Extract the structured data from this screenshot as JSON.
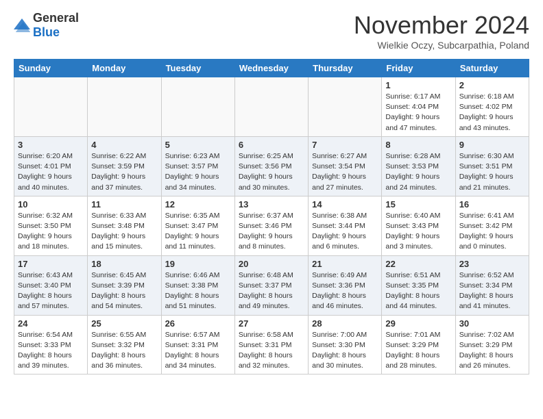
{
  "header": {
    "logo_general": "General",
    "logo_blue": "Blue",
    "month_title": "November 2024",
    "subtitle": "Wielkie Oczy, Subcarpathia, Poland"
  },
  "days_of_week": [
    "Sunday",
    "Monday",
    "Tuesday",
    "Wednesday",
    "Thursday",
    "Friday",
    "Saturday"
  ],
  "weeks": [
    {
      "row_class": "row-even",
      "days": [
        {
          "num": "",
          "info": "",
          "empty": true
        },
        {
          "num": "",
          "info": "",
          "empty": true
        },
        {
          "num": "",
          "info": "",
          "empty": true
        },
        {
          "num": "",
          "info": "",
          "empty": true
        },
        {
          "num": "",
          "info": "",
          "empty": true
        },
        {
          "num": "1",
          "info": "Sunrise: 6:17 AM\nSunset: 4:04 PM\nDaylight: 9 hours\nand 47 minutes.",
          "empty": false
        },
        {
          "num": "2",
          "info": "Sunrise: 6:18 AM\nSunset: 4:02 PM\nDaylight: 9 hours\nand 43 minutes.",
          "empty": false
        }
      ]
    },
    {
      "row_class": "row-odd",
      "days": [
        {
          "num": "3",
          "info": "Sunrise: 6:20 AM\nSunset: 4:01 PM\nDaylight: 9 hours\nand 40 minutes.",
          "empty": false
        },
        {
          "num": "4",
          "info": "Sunrise: 6:22 AM\nSunset: 3:59 PM\nDaylight: 9 hours\nand 37 minutes.",
          "empty": false
        },
        {
          "num": "5",
          "info": "Sunrise: 6:23 AM\nSunset: 3:57 PM\nDaylight: 9 hours\nand 34 minutes.",
          "empty": false
        },
        {
          "num": "6",
          "info": "Sunrise: 6:25 AM\nSunset: 3:56 PM\nDaylight: 9 hours\nand 30 minutes.",
          "empty": false
        },
        {
          "num": "7",
          "info": "Sunrise: 6:27 AM\nSunset: 3:54 PM\nDaylight: 9 hours\nand 27 minutes.",
          "empty": false
        },
        {
          "num": "8",
          "info": "Sunrise: 6:28 AM\nSunset: 3:53 PM\nDaylight: 9 hours\nand 24 minutes.",
          "empty": false
        },
        {
          "num": "9",
          "info": "Sunrise: 6:30 AM\nSunset: 3:51 PM\nDaylight: 9 hours\nand 21 minutes.",
          "empty": false
        }
      ]
    },
    {
      "row_class": "row-even",
      "days": [
        {
          "num": "10",
          "info": "Sunrise: 6:32 AM\nSunset: 3:50 PM\nDaylight: 9 hours\nand 18 minutes.",
          "empty": false
        },
        {
          "num": "11",
          "info": "Sunrise: 6:33 AM\nSunset: 3:48 PM\nDaylight: 9 hours\nand 15 minutes.",
          "empty": false
        },
        {
          "num": "12",
          "info": "Sunrise: 6:35 AM\nSunset: 3:47 PM\nDaylight: 9 hours\nand 11 minutes.",
          "empty": false
        },
        {
          "num": "13",
          "info": "Sunrise: 6:37 AM\nSunset: 3:46 PM\nDaylight: 9 hours\nand 8 minutes.",
          "empty": false
        },
        {
          "num": "14",
          "info": "Sunrise: 6:38 AM\nSunset: 3:44 PM\nDaylight: 9 hours\nand 6 minutes.",
          "empty": false
        },
        {
          "num": "15",
          "info": "Sunrise: 6:40 AM\nSunset: 3:43 PM\nDaylight: 9 hours\nand 3 minutes.",
          "empty": false
        },
        {
          "num": "16",
          "info": "Sunrise: 6:41 AM\nSunset: 3:42 PM\nDaylight: 9 hours\nand 0 minutes.",
          "empty": false
        }
      ]
    },
    {
      "row_class": "row-odd",
      "days": [
        {
          "num": "17",
          "info": "Sunrise: 6:43 AM\nSunset: 3:40 PM\nDaylight: 8 hours\nand 57 minutes.",
          "empty": false
        },
        {
          "num": "18",
          "info": "Sunrise: 6:45 AM\nSunset: 3:39 PM\nDaylight: 8 hours\nand 54 minutes.",
          "empty": false
        },
        {
          "num": "19",
          "info": "Sunrise: 6:46 AM\nSunset: 3:38 PM\nDaylight: 8 hours\nand 51 minutes.",
          "empty": false
        },
        {
          "num": "20",
          "info": "Sunrise: 6:48 AM\nSunset: 3:37 PM\nDaylight: 8 hours\nand 49 minutes.",
          "empty": false
        },
        {
          "num": "21",
          "info": "Sunrise: 6:49 AM\nSunset: 3:36 PM\nDaylight: 8 hours\nand 46 minutes.",
          "empty": false
        },
        {
          "num": "22",
          "info": "Sunrise: 6:51 AM\nSunset: 3:35 PM\nDaylight: 8 hours\nand 44 minutes.",
          "empty": false
        },
        {
          "num": "23",
          "info": "Sunrise: 6:52 AM\nSunset: 3:34 PM\nDaylight: 8 hours\nand 41 minutes.",
          "empty": false
        }
      ]
    },
    {
      "row_class": "row-even",
      "days": [
        {
          "num": "24",
          "info": "Sunrise: 6:54 AM\nSunset: 3:33 PM\nDaylight: 8 hours\nand 39 minutes.",
          "empty": false
        },
        {
          "num": "25",
          "info": "Sunrise: 6:55 AM\nSunset: 3:32 PM\nDaylight: 8 hours\nand 36 minutes.",
          "empty": false
        },
        {
          "num": "26",
          "info": "Sunrise: 6:57 AM\nSunset: 3:31 PM\nDaylight: 8 hours\nand 34 minutes.",
          "empty": false
        },
        {
          "num": "27",
          "info": "Sunrise: 6:58 AM\nSunset: 3:31 PM\nDaylight: 8 hours\nand 32 minutes.",
          "empty": false
        },
        {
          "num": "28",
          "info": "Sunrise: 7:00 AM\nSunset: 3:30 PM\nDaylight: 8 hours\nand 30 minutes.",
          "empty": false
        },
        {
          "num": "29",
          "info": "Sunrise: 7:01 AM\nSunset: 3:29 PM\nDaylight: 8 hours\nand 28 minutes.",
          "empty": false
        },
        {
          "num": "30",
          "info": "Sunrise: 7:02 AM\nSunset: 3:29 PM\nDaylight: 8 hours\nand 26 minutes.",
          "empty": false
        }
      ]
    }
  ]
}
